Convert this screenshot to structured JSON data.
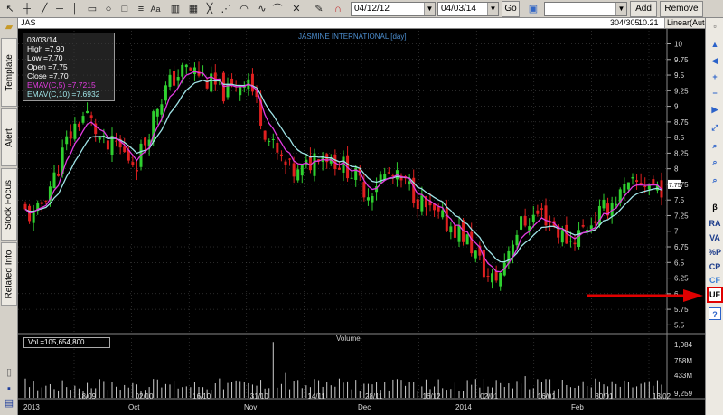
{
  "toolbar": {
    "date_from": "04/12/12",
    "date_to": "04/03/14",
    "go_label": "Go",
    "add_label": "Add",
    "remove_label": "Remove",
    "text_tool_label": "Aa"
  },
  "left_tabs": [
    "Template",
    "Alert",
    "Stock Focus",
    "Related Info"
  ],
  "header": {
    "symbol": "JAS",
    "count": "304/305",
    "price": "10.21",
    "scale_mode": "Linear(Auto)"
  },
  "chart_title": "JASMINE INTERNATIONAL [day]",
  "info": {
    "date": "03/03/14",
    "high": "High =7.90",
    "low": "Low =7.70",
    "open": "Open =7.75",
    "close": "Close =7.70",
    "emav5": "EMAV(C,5) =7.7215",
    "emav10": "EMAV(C,10) =7.6932"
  },
  "volume": {
    "label": "Vol =105,654,800",
    "title": "Volume",
    "ticks": [
      "1,084",
      "758M",
      "433M",
      "9,259"
    ]
  },
  "right_bar": {
    "beta": "β",
    "ra": "RA",
    "va": "VA",
    "pp": "%P",
    "cp": "CP",
    "cf": "CF",
    "uf": "UF",
    "help": "?",
    "colors": {
      "uf_highlight": "#e00000"
    }
  },
  "chart_data": {
    "type": "candlestick",
    "title": "JASMINE INTERNATIONAL [day]",
    "ylim": [
      5.375,
      10.21
    ],
    "y_ticks": [
      "10",
      "9.75",
      "9.5",
      "9.25",
      "9",
      "8.75",
      "8.5",
      "8.25",
      "8",
      "7.75",
      "7.5",
      "7.25",
      "7",
      "6.75",
      "6.5",
      "6.25",
      "6",
      "5.75",
      "5.5"
    ],
    "last_price": "7.75",
    "x_date_labels": [
      "18/09",
      "02/10",
      "16/10",
      "31/10",
      "14/11",
      "28/11",
      "16/12",
      "02/01",
      "16/01",
      "30/01",
      "13/02"
    ],
    "x_month_labels": [
      "2013",
      "Oct",
      "Nov",
      "Dec",
      "2014",
      "Feb"
    ],
    "close_path": [
      7.3,
      7.2,
      7.6,
      7.9,
      8.4,
      8.7,
      8.9,
      8.6,
      8.3,
      8.4,
      8.2,
      8.1,
      8.5,
      9.0,
      9.3,
      9.5,
      9.6,
      9.55,
      9.4,
      9.3,
      9.2,
      9.35,
      9.5,
      9.0,
      8.5,
      8.2,
      8.0,
      7.9,
      8.05,
      8.3,
      8.2,
      8.1,
      8.0,
      7.8,
      7.6,
      7.85,
      7.9,
      7.8,
      7.7,
      7.5,
      7.3,
      7.2,
      7.1,
      7.0,
      6.8,
      6.5,
      6.2,
      6.3,
      6.8,
      7.1,
      7.2,
      7.3,
      7.15,
      6.95,
      6.85,
      7.0,
      7.15,
      7.3,
      7.45,
      7.6,
      7.7,
      7.8,
      7.75,
      7.7
    ],
    "series": [
      {
        "name": "EMAV(C,5)",
        "color": "#e23be0"
      },
      {
        "name": "EMAV(C,10)",
        "color": "#9fe3e6"
      },
      {
        "name": "Vol",
        "color": "#cfcfcf"
      }
    ],
    "colors": {
      "up": "#2fd02f",
      "down": "#e02020",
      "grid": "#555555"
    }
  }
}
